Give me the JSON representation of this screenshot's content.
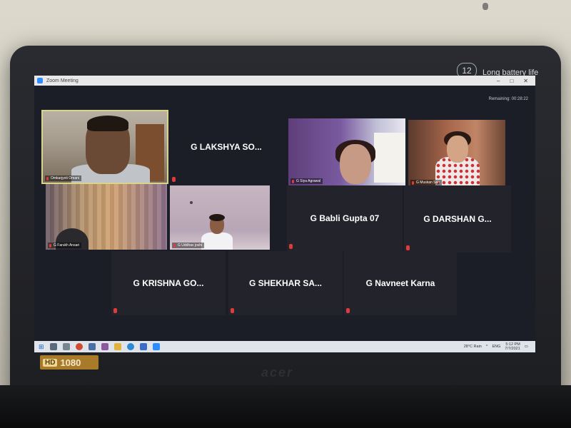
{
  "window": {
    "title": "Zoom Meeting",
    "controls": [
      "–",
      "□",
      "✕"
    ],
    "top_info": "Remaining: 00:28:22"
  },
  "device": {
    "battery_badge": "12",
    "battery_text": "Long battery life",
    "brand": "acer",
    "hd_badge": "HD",
    "hd_resolution": "1080"
  },
  "participants": [
    {
      "name": "Omkarjyoti Omani",
      "video": true
    },
    {
      "name": "G LAKSHYA SO...",
      "video": false
    },
    {
      "name": "G Siya Agrawal",
      "video": true
    },
    {
      "name": "G Muskan Sah",
      "video": true
    },
    {
      "name": "G Farukh Ansari",
      "video": true
    },
    {
      "name": "G Uddhav joshi",
      "video": true
    },
    {
      "name": "G Babli Gupta 07",
      "video": false
    },
    {
      "name": "G DARSHAN G...",
      "video": false
    },
    {
      "name": "G KRISHNA GO...",
      "video": false
    },
    {
      "name": "G SHEKHAR SA...",
      "video": false
    },
    {
      "name": "G Navneet Karna",
      "video": false
    }
  ],
  "taskbar": {
    "weather": "28°C  Rain",
    "language": "ENG",
    "time": "5:12 PM",
    "date": "7/7/2021",
    "icons": [
      "search",
      "task-view",
      "chrome",
      "store",
      "photos",
      "explorer",
      "edge",
      "mail",
      "zoom"
    ]
  },
  "colors": {
    "tile_bg": "#22232b",
    "active_border": "#d8d48a",
    "mic_muted": "#e03b3b",
    "meeting_bg": "#1c1e27"
  }
}
